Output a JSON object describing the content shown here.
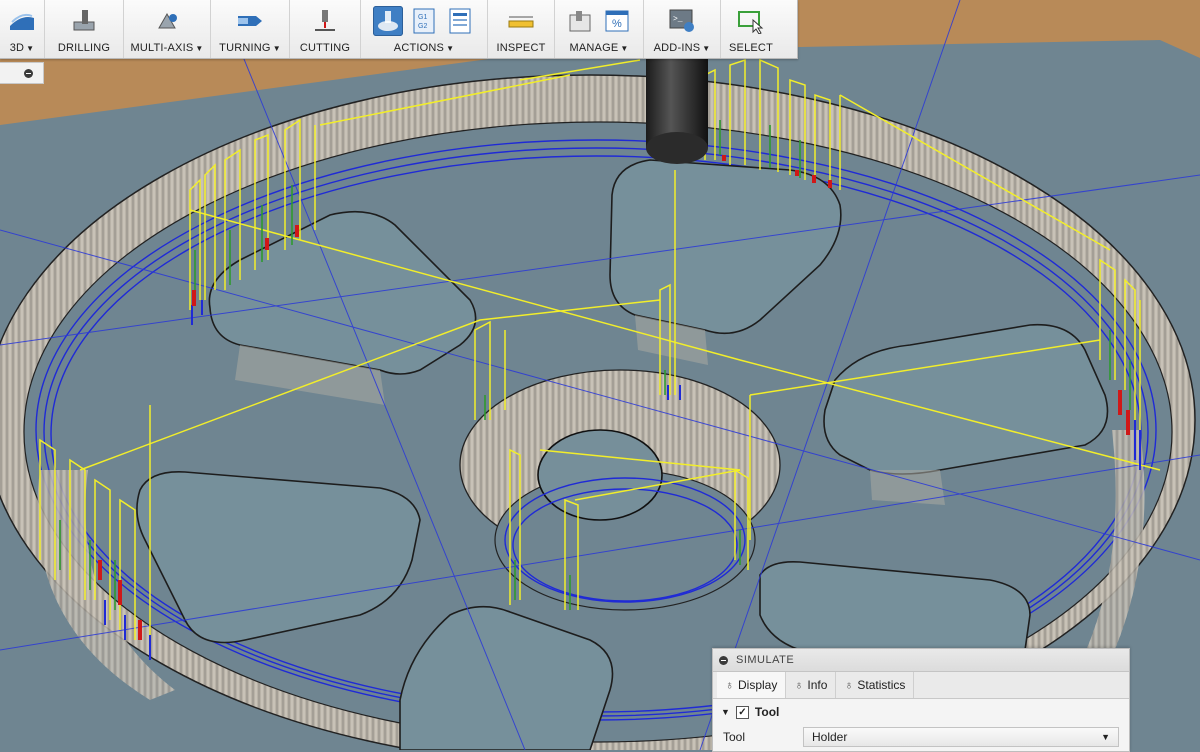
{
  "toolbar": {
    "groups": [
      {
        "label": "3D",
        "dropdown": true
      },
      {
        "label": "DRILLING",
        "dropdown": false
      },
      {
        "label": "MULTI-AXIS",
        "dropdown": true
      },
      {
        "label": "TURNING",
        "dropdown": true
      },
      {
        "label": "CUTTING",
        "dropdown": false
      },
      {
        "label": "ACTIONS",
        "dropdown": true
      },
      {
        "label": "INSPECT",
        "dropdown": false
      },
      {
        "label": "MANAGE",
        "dropdown": true
      },
      {
        "label": "ADD-INS",
        "dropdown": true
      },
      {
        "label": "SELECT",
        "dropdown": false
      }
    ],
    "arrow": "▼",
    "actions_g1_label": "G1",
    "actions_g2_label": "G2",
    "manage_percent": "%"
  },
  "simulate": {
    "title": "SIMULATE",
    "tabs": [
      {
        "label": "Display",
        "icon": "lightbulb-icon"
      },
      {
        "label": "Info",
        "icon": "info-lightbulb-icon"
      },
      {
        "label": "Statistics",
        "icon": "statistics-lightbulb-icon"
      }
    ],
    "section": {
      "label": "Tool",
      "checked": true
    },
    "row": {
      "label": "Tool",
      "value": "Holder"
    }
  },
  "colors": {
    "toolpath": "#f2ee2a",
    "lead": "#1f2ad6",
    "plunge": "#2e9a2e",
    "rapid_end": "#d01818",
    "stock": "#b8b2a6",
    "floor": "#6f8591",
    "table": "#b88a58",
    "active_icon": "#3f7fc4"
  }
}
